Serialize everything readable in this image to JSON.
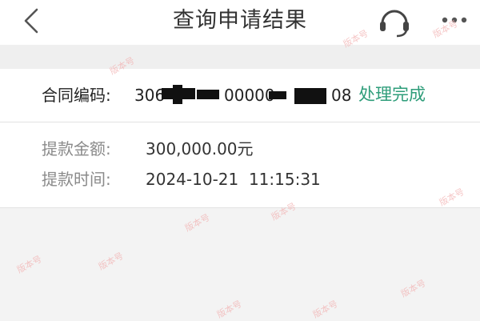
{
  "nav": {
    "title": "查询申请结果",
    "back_icon": "chevron-left-icon",
    "service_icon": "headset-icon",
    "more_icon": "more-dots-icon"
  },
  "contract": {
    "label": "合同编码:",
    "number_visible_prefix": "306",
    "number_visible_middle": "00000",
    "number_visible_suffix": "08",
    "status": "处理完成",
    "status_color": "#2e9d7a"
  },
  "details": [
    {
      "label": "提款金额:",
      "value": "300,000.00元"
    },
    {
      "label": "提款时间:",
      "value": "2024-10-21  11:15:31"
    }
  ],
  "watermark": "版本号"
}
